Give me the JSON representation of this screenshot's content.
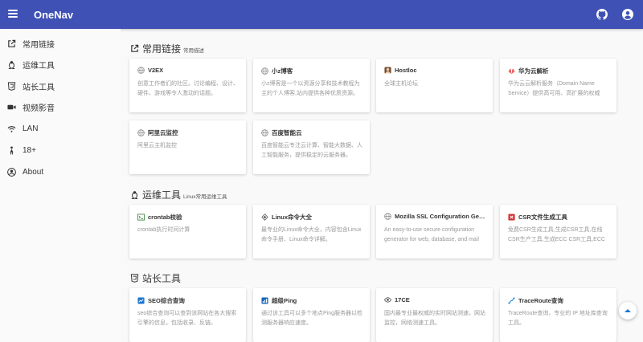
{
  "header": {
    "brand": "OneNav"
  },
  "sidebar": {
    "items": [
      {
        "label": "常用链接",
        "icon": "external-link-icon"
      },
      {
        "label": "运维工具",
        "icon": "linux-icon"
      },
      {
        "label": "站长工具",
        "icon": "html5-icon"
      },
      {
        "label": "视频影音",
        "icon": "video-icon"
      },
      {
        "label": "LAN",
        "icon": "wifi-icon"
      },
      {
        "label": "18+",
        "icon": "female-icon"
      },
      {
        "label": "About",
        "icon": "user-icon"
      }
    ]
  },
  "sections": [
    {
      "title": "常用链接",
      "subtitle": "常用描述",
      "icon": "external-link-icon",
      "cards": [
        {
          "title": "V2EX",
          "desc": "创意工作者们的社区。讨论编程、设计、硬件、游戏等令人激动的话题。",
          "icon": "globe-icon"
        },
        {
          "title": "小z博客",
          "desc": "小z博客是一个以资源分享和技术教程为主的个人博客,站内提供各种优质资源。",
          "icon": "globe-icon"
        },
        {
          "title": "Hostloc",
          "desc": "全球主机论坛",
          "icon": "avatar-icon"
        },
        {
          "title": "华为云解析",
          "desc": "华为云云解析服务（Domain Name Service）提供高可用、高扩展的权威DNS服务。",
          "icon": "huawei-icon"
        },
        {
          "title": "阿里云监控",
          "desc": "阿里云主机监控",
          "icon": "globe-icon"
        },
        {
          "title": "百度智能云",
          "desc": "百度智能云专注云计算、智能大数据、人工智能服务，提供稳定的云服务器。",
          "icon": "globe-icon"
        }
      ]
    },
    {
      "title": "运维工具",
      "subtitle": "Linux常用运维工具",
      "icon": "linux-icon",
      "cards": [
        {
          "title": "crontab校验",
          "desc": "crontab执行时间计算",
          "icon": "terminal-icon"
        },
        {
          "title": "Linux命令大全",
          "desc": "最专业的Linux命令大全，内容包含Linux命令手册、Linux命令详解。",
          "icon": "diamond-icon"
        },
        {
          "title": "Mozilla SSL Configuration Generator",
          "desc": "An easy-to-use secure configuration generator for web, database, and mail software.",
          "icon": "globe-icon"
        },
        {
          "title": "CSR文件生成工具",
          "desc": "免费CSR生成工具,生成CSR工具,在线CSR生产工具,生成ECC CSR工具,ECC CSR在线生成。",
          "icon": "csr-icon"
        }
      ]
    },
    {
      "title": "站长工具",
      "subtitle": "",
      "icon": "html5-icon",
      "cards": [
        {
          "title": "SEO综合查询",
          "desc": "seo综合查询可以查到该网站在各大搜索引擎的信息，包括收录、反链。",
          "icon": "seo-icon"
        },
        {
          "title": "超级Ping",
          "desc": "通过该工具可以多个地点Ping服务器以检测服务器响应速度。",
          "icon": "ping-icon"
        },
        {
          "title": "17CE",
          "desc": "国内最专业最权威的实时网站测速，网站监控，网络测速工具。",
          "icon": "eye-icon"
        },
        {
          "title": "TraceRoute查询",
          "desc": "TraceRoute查询，专业的 IP 地址库查询工具。",
          "icon": "trace-icon"
        }
      ]
    }
  ],
  "colors": {
    "primary": "#3f51b5",
    "card": "#ffffff",
    "desc": "#999999"
  }
}
